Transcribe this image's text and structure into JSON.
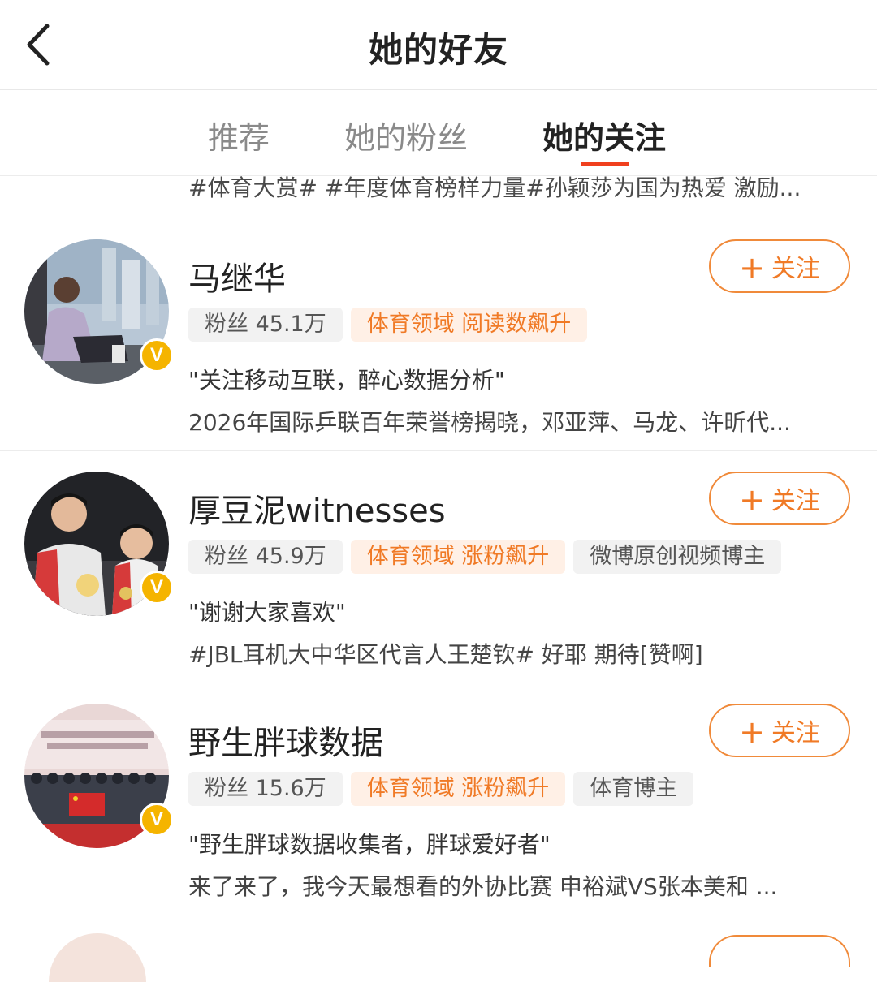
{
  "header": {
    "title": "她的好友"
  },
  "tabs": [
    {
      "label": "推荐",
      "active": false
    },
    {
      "label": "她的粉丝",
      "active": false
    },
    {
      "label": "她的关注",
      "active": true
    }
  ],
  "partial_line": "#体育大赏# #年度体育榜样力量#孙颖莎为国为热爱 激励...",
  "follow_label": "关注",
  "users": [
    {
      "name": "马继华",
      "fans": "粉丝 45.1万",
      "tags": [
        {
          "text": "体育领域 阅读数飙升",
          "style": "orange"
        }
      ],
      "bio": "\"关注移动互联，醉心数据分析\"",
      "latest": "2026年国际乒联百年荣誉榜揭晓，邓亚萍、马龙、许昕代..."
    },
    {
      "name": "厚豆泥witnesses",
      "fans": "粉丝 45.9万",
      "tags": [
        {
          "text": "体育领域 涨粉飙升",
          "style": "orange"
        },
        {
          "text": "微博原创视频博主",
          "style": "gray"
        }
      ],
      "bio": "\"谢谢大家喜欢\"",
      "latest": "#JBL耳机大中华区代言人王楚钦# 好耶 期待[赞啊]"
    },
    {
      "name": "野生胖球数据",
      "fans": "粉丝 15.6万",
      "tags": [
        {
          "text": "体育领域 涨粉飙升",
          "style": "orange"
        },
        {
          "text": "体育博主",
          "style": "gray"
        }
      ],
      "bio": "\"野生胖球数据收集者，胖球爱好者\"",
      "latest": "来了来了，我今天最想看的外协比赛 申裕斌VS张本美和 ..."
    }
  ],
  "colors": {
    "accent": "#f07a26",
    "tab_indicator": "#f0401e",
    "verified": "#f5b400"
  }
}
